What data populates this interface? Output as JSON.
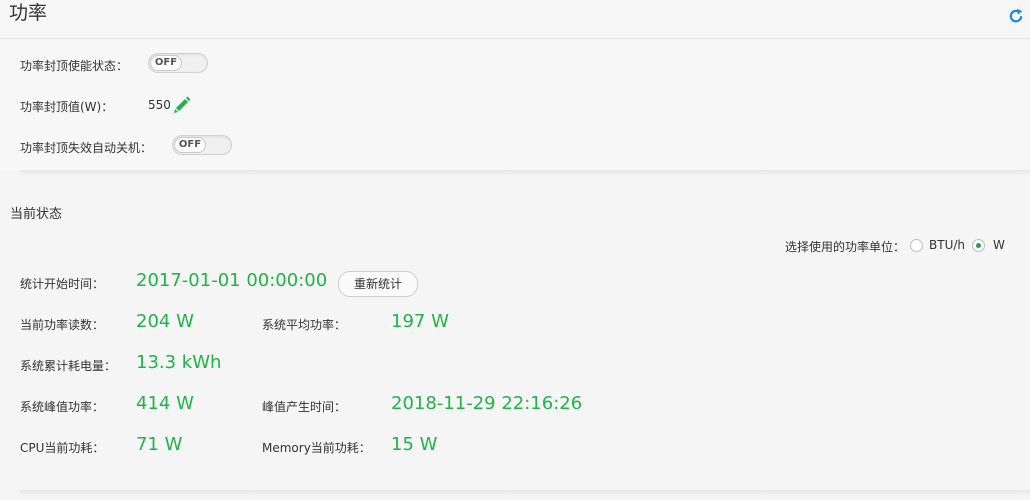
{
  "header": {
    "title": "功率",
    "refresh_icon": "refresh-icon",
    "accent": "#1a8ad4"
  },
  "power_cap": {
    "enable_label": "功率封顶使能状态：",
    "enable_state": "OFF",
    "value_label": "功率封顶值(W)：",
    "value": "550",
    "edit_icon": "pencil-icon",
    "auto_off_label": "功率封顶失效自动关机：",
    "auto_off_state": "OFF"
  },
  "current_status": {
    "title": "当前状态",
    "unit_select": {
      "label": "选择使用的功率单位：",
      "options": [
        {
          "label": "BTU/h",
          "checked": false
        },
        {
          "label": "W",
          "checked": true
        }
      ]
    },
    "start_time_label": "统计开始时间：",
    "start_time": "2017-01-01 00:00:00",
    "reset_button": "重新统计",
    "current_reading_label": "当前功率读数：",
    "current_reading": "204 W",
    "avg_power_label": "系统平均功率：",
    "avg_power": "197 W",
    "energy_label": "系统累计耗电量：",
    "energy": "13.3 kWh",
    "peak_label": "系统峰值功率：",
    "peak": "414 W",
    "peak_time_label": "峰值产生时间：",
    "peak_time": "2018-11-29 22:16:26",
    "cpu_label": "CPU当前功耗：",
    "cpu": "71 W",
    "memory_label": "Memory当前功耗：",
    "memory": "15 W",
    "value_color": "#21b34a"
  }
}
